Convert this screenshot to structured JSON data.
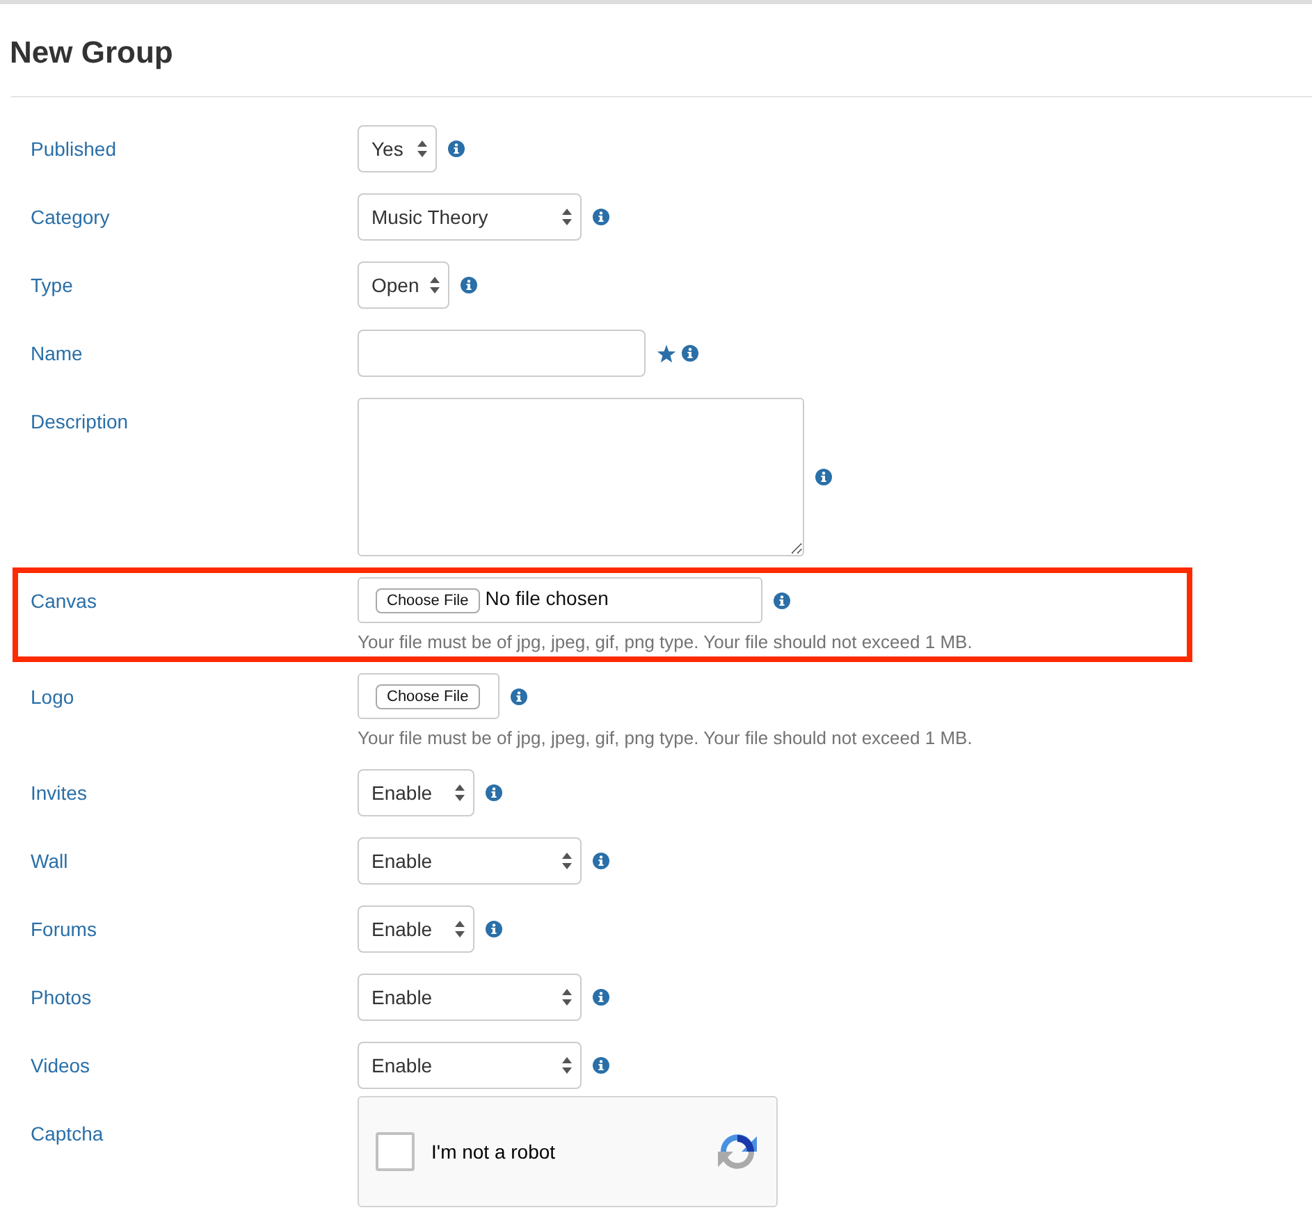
{
  "title": "New Group",
  "fields": [
    {
      "label": "Published",
      "kind": "select",
      "value": "Yes",
      "wide": false,
      "info": true
    },
    {
      "label": "Category",
      "kind": "select",
      "value": "Music Theory",
      "wide": true,
      "info": true
    },
    {
      "label": "Type",
      "kind": "select",
      "value": "Open",
      "wide": false,
      "info": true
    },
    {
      "label": "Name",
      "kind": "text",
      "required": true,
      "info": true
    },
    {
      "label": "Description",
      "kind": "textarea",
      "info": true
    },
    {
      "label": "Canvas",
      "kind": "file",
      "button": "Choose File",
      "status": "No file chosen",
      "hint": "Your file must be of jpg, jpeg, gif, png type. Your file should not exceed 1 MB.",
      "highlighted": true,
      "info": true
    },
    {
      "label": "Logo",
      "kind": "file",
      "button": "Choose File",
      "hint": "Your file must be of jpg, jpeg, gif, png type. Your file should not exceed 1 MB.",
      "highlighted": false,
      "info": true
    },
    {
      "label": "Invites",
      "kind": "select",
      "value": "Enable",
      "wide": false,
      "info": true
    },
    {
      "label": "Wall",
      "kind": "select",
      "value": "Enable",
      "wide": true,
      "info": true
    },
    {
      "label": "Forums",
      "kind": "select",
      "value": "Enable",
      "wide": false,
      "info": true
    },
    {
      "label": "Photos",
      "kind": "select",
      "value": "Enable",
      "wide": true,
      "info": true
    },
    {
      "label": "Videos",
      "kind": "select",
      "value": "Enable",
      "wide": true,
      "info": true
    },
    {
      "label": "Captcha",
      "kind": "captcha",
      "text": "I'm not a robot",
      "checked": false
    }
  ]
}
